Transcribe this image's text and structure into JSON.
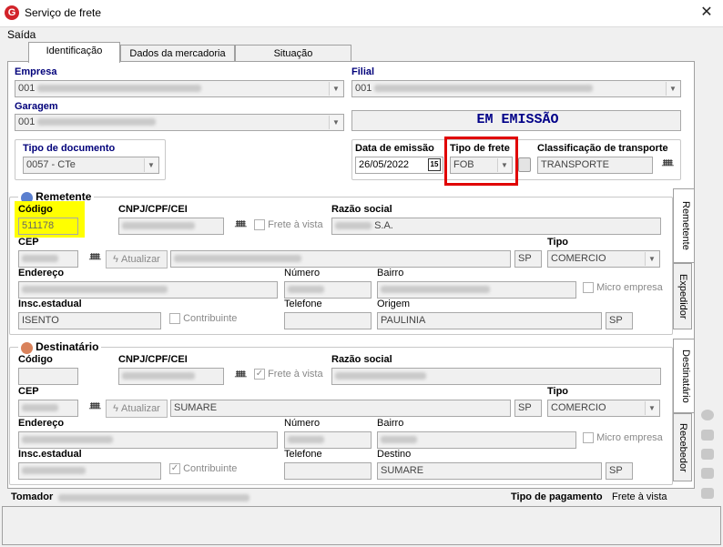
{
  "window": {
    "title": "Serviço de frete",
    "close_glyph": "✕",
    "icon_letter": "G"
  },
  "menu": {
    "saida": "Saída"
  },
  "tabs": [
    {
      "label": "Identificação",
      "active": true
    },
    {
      "label": "Dados da mercadoria",
      "active": false
    },
    {
      "label": "Situação",
      "active": false
    }
  ],
  "header": {
    "empresa_label": "Empresa",
    "empresa_value": "001",
    "filial_label": "Filial",
    "filial_value": "001",
    "garagem_label": "Garagem",
    "garagem_value": "001",
    "status_text": "EM EMISSÃO",
    "tipo_documento_label": "Tipo de documento",
    "tipo_documento_value": "0057 - CTe",
    "data_emissao_label": "Data de emissão",
    "data_emissao_value": "26/05/2022",
    "calendar_glyph": "15",
    "tipo_frete_label": "Tipo de frete",
    "tipo_frete_value": "FOB",
    "classificacao_label": "Classificação de transporte",
    "classificacao_value": "TRANSPORTE"
  },
  "remetente": {
    "title": "Remetente",
    "codigo_label": "Código",
    "codigo_value": "511178",
    "cnpj_label": "CNPJ/CPF/CEI",
    "frete_vista_label": "Frete à vista",
    "razao_label": "Razão social",
    "razao_value": "S.A.",
    "cep_label": "CEP",
    "atualizar_label": "Atualizar",
    "uf_value": "SP",
    "tipo_label": "Tipo",
    "tipo_value": "COMERCIO",
    "endereco_label": "Endereço",
    "numero_label": "Número",
    "bairro_label": "Bairro",
    "micro_empresa_label": "Micro empresa",
    "insc_label": "Insc.estadual",
    "insc_value": "ISENTO",
    "contribuinte_label": "Contribuinte",
    "telefone_label": "Telefone",
    "origem_label": "Origem",
    "origem_value": "PAULINIA",
    "origem_uf": "SP"
  },
  "destinatario": {
    "title": "Destinatário",
    "codigo_label": "Código",
    "cnpj_label": "CNPJ/CPF/CEI",
    "frete_vista_label": "Frete à vista",
    "razao_label": "Razão social",
    "cep_label": "CEP",
    "atualizar_label": "Atualizar",
    "cidade_value": "SUMARE",
    "uf_value": "SP",
    "tipo_label": "Tipo",
    "tipo_value": "COMERCIO",
    "endereco_label": "Endereço",
    "numero_label": "Número",
    "bairro_label": "Bairro",
    "micro_empresa_label": "Micro empresa",
    "insc_label": "Insc.estadual",
    "contribuinte_label": "Contribuinte",
    "telefone_label": "Telefone",
    "destino_label": "Destino",
    "destino_value": "SUMARE",
    "destino_uf": "SP"
  },
  "vertical_tabs": {
    "remetente": "Remetente",
    "expedidor": "Expedidor",
    "destinatario": "Destinatário",
    "recebedor": "Recebedor"
  },
  "footer": {
    "tomador_label": "Tomador",
    "tipo_pagamento_label": "Tipo de pagamento",
    "tipo_pagamento_value": "Frete à vista"
  },
  "icons": {
    "binoculars": "ᚙ",
    "checkbox_mark": "✓",
    "dropdown": "▼",
    "lightning": "ϟ"
  },
  "colors": {
    "highlight_yellow": "#ffff00",
    "highlight_red_border": "#e00000",
    "label_blue": "#00007a"
  }
}
